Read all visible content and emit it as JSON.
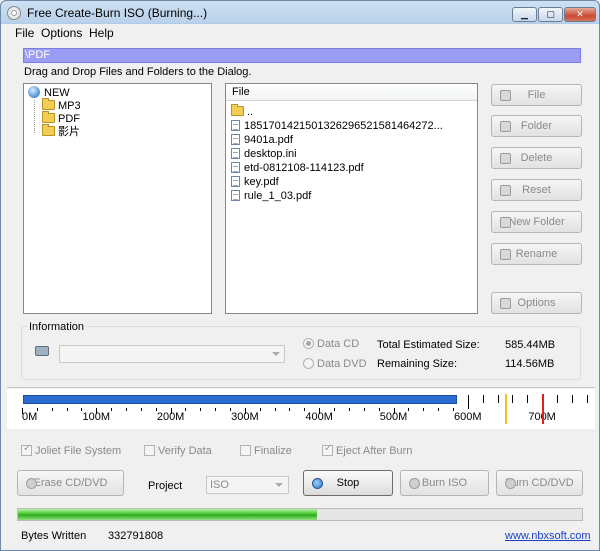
{
  "window": {
    "title": "Free Create-Burn ISO (Burning...)",
    "controls": {
      "minimize": "▁",
      "maximize": "▢",
      "close": "✕"
    }
  },
  "menu": [
    "File",
    "Options",
    "Help"
  ],
  "path": "\\PDF",
  "hint": "Drag and Drop Files and Folders to the Dialog.",
  "tree": {
    "root": "NEW",
    "children": [
      "MP3",
      "PDF",
      "影片"
    ]
  },
  "file_list": {
    "header": "File",
    "items": [
      {
        "name": "..",
        "type": "folder"
      },
      {
        "name": "18517014215013262965215814642​72...",
        "type": "file"
      },
      {
        "name": "9401a.pdf",
        "type": "file"
      },
      {
        "name": "desktop.ini",
        "type": "file"
      },
      {
        "name": "etd-0812108-114123.pdf",
        "type": "file"
      },
      {
        "name": "key.pdf",
        "type": "file"
      },
      {
        "name": "rule_1_03.pdf",
        "type": "file"
      }
    ]
  },
  "side_buttons": [
    "File",
    "Folder",
    "Delete",
    "Reset",
    "New Folder",
    "Rename",
    "Options"
  ],
  "information": {
    "title": "Information",
    "drive_value": "",
    "media_options": [
      {
        "label": "Data CD",
        "selected": true
      },
      {
        "label": "Data DVD",
        "selected": false
      }
    ],
    "total_label": "Total Estimated Size:",
    "total_value": "585.44MB",
    "remaining_label": "Remaining Size:",
    "remaining_value": "114.56MB"
  },
  "size_meter": {
    "max_mb": 780,
    "used_mb": 585.44,
    "labels": [
      "0M",
      "100M",
      "200M",
      "300M",
      "400M",
      "500M",
      "600M",
      "700M"
    ],
    "markers": [
      {
        "name": "yellow-limit-marker",
        "mb": 650,
        "color": "#f0c020"
      },
      {
        "name": "red-limit-marker",
        "mb": 700,
        "color": "#e02020"
      }
    ]
  },
  "options": [
    {
      "label": "Joliet File System",
      "checked": true
    },
    {
      "label": "Verify Data",
      "checked": false
    },
    {
      "label": "Finalize",
      "checked": false
    },
    {
      "label": "Eject After Burn",
      "checked": true
    }
  ],
  "actions": {
    "erase": "Erase CD/DVD",
    "project_label": "Project",
    "project_value": "ISO",
    "stop": "Stop",
    "burn_iso": "Burn ISO",
    "burn_cd": "Burn CD/DVD"
  },
  "progress": {
    "fraction": 0.53
  },
  "status": {
    "bytes_label": "Bytes Written",
    "bytes_value": "332791808",
    "link": "www.nbxsoft.com"
  }
}
